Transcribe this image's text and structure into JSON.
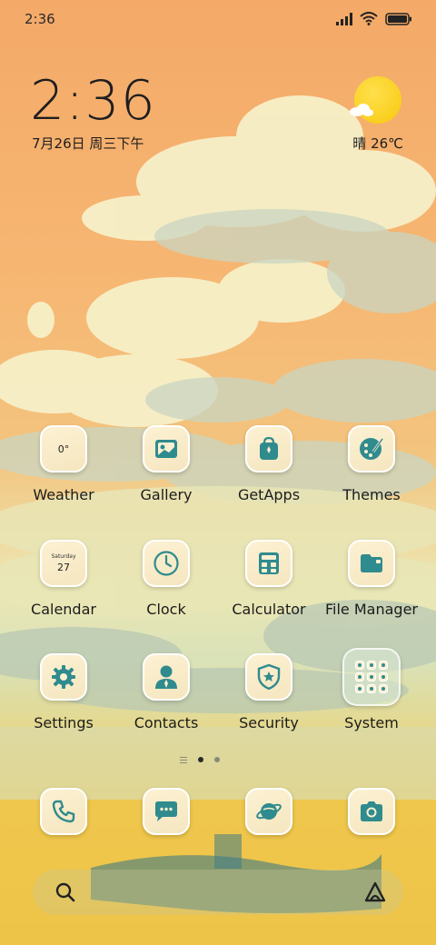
{
  "status_bar": {
    "time": "2:36",
    "icons": [
      "signal-icon",
      "wifi-icon",
      "battery-icon"
    ]
  },
  "clock_widget": {
    "time": "2:36",
    "date": "7月26日 周三下午"
  },
  "weather_widget": {
    "condition": "晴",
    "temperature": "26℃",
    "icon": "sun-cloud-icon"
  },
  "apps": [
    {
      "label": "Weather",
      "icon": "weather-icon",
      "icon_text": "0°"
    },
    {
      "label": "Gallery",
      "icon": "gallery-icon"
    },
    {
      "label": "GetApps",
      "icon": "getapps-icon"
    },
    {
      "label": "Themes",
      "icon": "themes-icon"
    },
    {
      "label": "Calendar",
      "icon": "calendar-icon",
      "icon_day": "Saturday",
      "icon_date": "27"
    },
    {
      "label": "Clock",
      "icon": "clock-icon"
    },
    {
      "label": "Calculator",
      "icon": "calculator-icon"
    },
    {
      "label": "File Manager",
      "icon": "folder-icon"
    },
    {
      "label": "Settings",
      "icon": "gear-icon"
    },
    {
      "label": "Contacts",
      "icon": "contact-icon"
    },
    {
      "label": "Security",
      "icon": "shield-icon"
    },
    {
      "label": "System",
      "icon": "app-folder-icon"
    }
  ],
  "page_indicator": {
    "pages": 2,
    "active": 1
  },
  "dock": [
    {
      "name": "phone",
      "icon": "phone-icon"
    },
    {
      "name": "messages",
      "icon": "message-icon"
    },
    {
      "name": "browser",
      "icon": "browser-icon"
    },
    {
      "name": "camera",
      "icon": "camera-icon"
    }
  ],
  "search_bar": {
    "left_icon": "search-icon",
    "right_icon": "assistant-icon"
  },
  "colors": {
    "icon_accent": "#2f8b8e",
    "icon_bg": "#fbf0d1",
    "sky_top": "#f4a968",
    "sun": "#f7c80d"
  }
}
